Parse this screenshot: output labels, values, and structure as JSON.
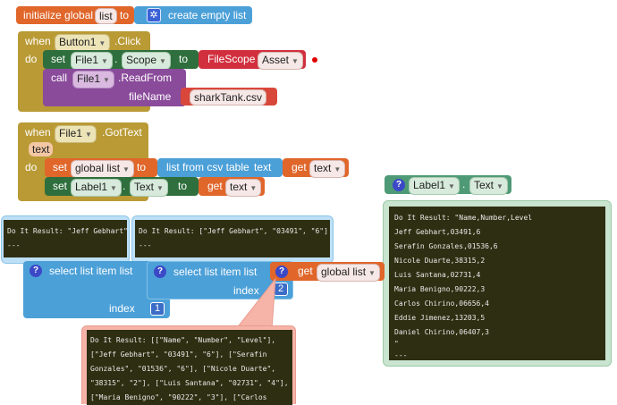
{
  "init_block": {
    "initialize": "initialize global",
    "var": "list",
    "to": "to",
    "create_empty_list": "create empty list"
  },
  "button_click": {
    "when": "when",
    "component": "Button1",
    "event": ".Click",
    "do": "do",
    "set": "set",
    "file_component": "File1",
    "property": "Scope",
    "to": "to",
    "filescope": "FileScope",
    "asset": "Asset",
    "call": "call",
    "call_component": "File1",
    "method": ".ReadFrom",
    "filename_label": "fileName",
    "filename_value": "sharkTank.csv"
  },
  "gottext": {
    "when": "when",
    "component": "File1",
    "event": ".GotText",
    "param": "text",
    "do": "do",
    "set1": "set",
    "var1": "global list",
    "to1": "to",
    "list_from_csv": "list from csv table",
    "text_label": "text",
    "get1": "get",
    "get1_var": "text",
    "set2": "set",
    "component2": "Label1",
    "property2": "Text",
    "to2": "to",
    "get2": "get",
    "get2_var": "text"
  },
  "label_getter": {
    "component": "Label1",
    "property": "Text"
  },
  "result_jeff": {
    "lines": [
      "Do It Result: \"Jeff Gebhart\"",
      "---"
    ]
  },
  "result_row": {
    "lines": [
      "Do It Result: [\"Jeff Gebhart\", \"03491\", \"6\"]",
      "---"
    ]
  },
  "result_label": {
    "lines": [
      "Do It Result: \"Name,Number,Level",
      "Jeff Gebhart,03491,6",
      "Serafin Gonzales,01536,6",
      "Nicole Duarte,38315,2",
      "Luis Santana,02731,4",
      "Maria Benigno,90222,3",
      "Carlos Chirino,06656,4",
      "Eddie Jimenez,13203,5",
      "Daniel Chirino,06407,3",
      "\"",
      "---"
    ]
  },
  "result_list": {
    "lines": [
      "Do It Result: [[\"Name\", \"Number\", \"Level\"],",
      "[\"Jeff Gebhart\", \"03491\", \"6\"], [\"Serafin",
      "Gonzales\", \"01536\", \"6\"], [\"Nicole Duarte\",",
      "\"38315\", \"2\"], [\"Luis Santana\", \"02731\", \"4\"],",
      "[\"Maria Benigno\", \"90222\", \"3\"], [\"Carlos"
    ]
  },
  "select_outer": {
    "label": "select list item  list",
    "index_label": "index",
    "index_value": "1"
  },
  "select_inner": {
    "label": "select list item  list",
    "index_label": "index",
    "index_value": "2"
  },
  "get_global": {
    "get": "get",
    "var": "global list"
  },
  "colors": {
    "variables": "#e0662a",
    "lists": "#4ca0d8",
    "file": "#8a4b9b",
    "control": "#b99a35",
    "label": "#2d7a45",
    "setter": "#2f6f3d",
    "label_getter": "#4f9a76",
    "scope_red": "#d22f3e",
    "text": "#d9473b",
    "error": "#e00000"
  }
}
